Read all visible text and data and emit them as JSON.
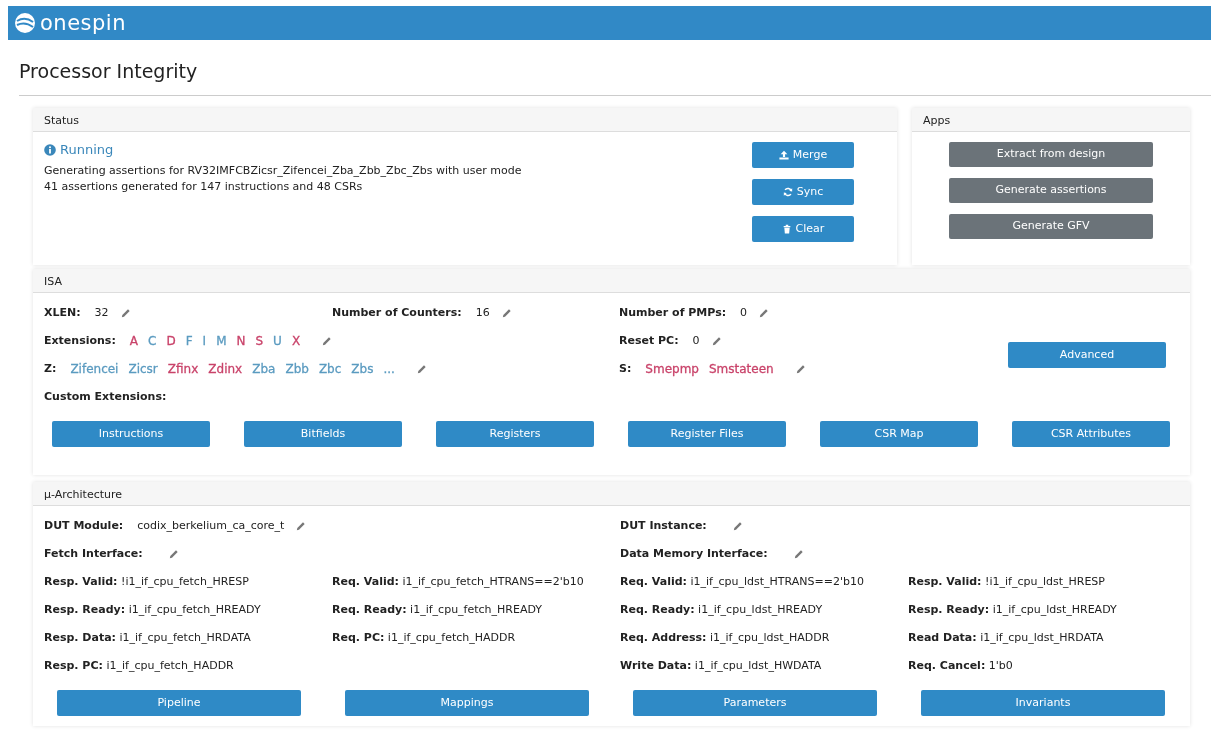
{
  "header": {
    "logo": "onespin"
  },
  "page_title": "Processor Integrity",
  "status": {
    "title": "Status",
    "state": "Running",
    "lines": [
      "Generating assertions for RV32IMFCBZicsr_Zifencei_Zba_Zbb_Zbc_Zbs with user mode",
      "41 assertions generated for 147 instructions and 48 CSRs"
    ],
    "buttons": [
      "Merge",
      "Sync",
      "Clear"
    ]
  },
  "apps": {
    "title": "Apps",
    "buttons": [
      "Extract from design",
      "Generate assertions",
      "Generate GFV"
    ]
  },
  "isa": {
    "title": "ISA",
    "items": [
      {
        "kind": "value",
        "label": "XLEN:",
        "value": "32",
        "editable": true
      },
      {
        "kind": "value",
        "label": "Number of Counters:",
        "value": "16",
        "editable": true
      },
      {
        "kind": "value",
        "label": "Number of PMPs:",
        "value": "0",
        "editable": true
      },
      {
        "kind": "tags",
        "label": "Extensions:",
        "editable": true,
        "tags": [
          {
            "text": "A",
            "color": "#c9436a"
          },
          {
            "text": "C",
            "color": "#5b9bc0"
          },
          {
            "text": "D",
            "color": "#c9436a"
          },
          {
            "text": "F",
            "color": "#5b9bc0"
          },
          {
            "text": "I",
            "color": "#5b9bc0"
          },
          {
            "text": "M",
            "color": "#5b9bc0"
          },
          {
            "text": "N",
            "color": "#c9436a"
          },
          {
            "text": "S",
            "color": "#c9436a"
          },
          {
            "text": "U",
            "color": "#5b9bc0"
          },
          {
            "text": "X",
            "color": "#c9436a"
          }
        ]
      },
      {
        "kind": "value",
        "label": "Reset PC:",
        "value": "0",
        "editable": true
      },
      {
        "kind": "tags",
        "label": "Z:",
        "editable": true,
        "tags": [
          {
            "text": "Zifencei",
            "color": "#5b9bc0"
          },
          {
            "text": "Zicsr",
            "color": "#5b9bc0"
          },
          {
            "text": "Zfinx",
            "color": "#c9436a"
          },
          {
            "text": "Zdinx",
            "color": "#c9436a"
          },
          {
            "text": "Zba",
            "color": "#5b9bc0"
          },
          {
            "text": "Zbb",
            "color": "#5b9bc0"
          },
          {
            "text": "Zbc",
            "color": "#5b9bc0"
          },
          {
            "text": "Zbs",
            "color": "#5b9bc0"
          }
        ],
        "more": "..."
      },
      {
        "kind": "tags",
        "label": "S:",
        "editable": true,
        "tags": [
          {
            "text": "Smepmp",
            "color": "#c9436a"
          },
          {
            "text": "Smstateen",
            "color": "#c9436a"
          }
        ]
      },
      {
        "kind": "value",
        "label": "Custom Extensions:",
        "editable": false
      }
    ],
    "advanced_button": "Advanced",
    "buttons": [
      "Instructions",
      "Bitfields",
      "Registers",
      "Register Files",
      "CSR Map",
      "CSR Attributes"
    ]
  },
  "uarch": {
    "title": "µ-Architecture",
    "groups": [
      {
        "fields": [
          {
            "label": "DUT Module:",
            "value": "codix_berkelium_ca_core_t",
            "editable": true
          },
          {
            "label": "Fetch Interface:",
            "editable": true
          }
        ],
        "signals": [
          {
            "label": "Resp. Valid:",
            "value": "!i1_if_cpu_fetch_HRESP"
          },
          {
            "label": "Req. Valid:",
            "value": "i1_if_cpu_fetch_HTRANS==2'b10"
          },
          {
            "label": "Resp. Ready:",
            "value": "i1_if_cpu_fetch_HREADY"
          },
          {
            "label": "Req. Ready:",
            "value": "i1_if_cpu_fetch_HREADY"
          },
          {
            "label": "Resp. Data:",
            "value": "i1_if_cpu_fetch_HRDATA"
          },
          {
            "label": "Req. PC:",
            "value": "i1_if_cpu_fetch_HADDR"
          },
          {
            "label": "Resp. PC:",
            "value": "i1_if_cpu_fetch_HADDR"
          }
        ],
        "buttons": [
          "Pipeline",
          "Mappings"
        ]
      },
      {
        "fields": [
          {
            "label": "DUT Instance:",
            "editable": true
          },
          {
            "label": "Data Memory Interface:",
            "editable": true
          }
        ],
        "signals": [
          {
            "label": "Req. Valid:",
            "value": "i1_if_cpu_ldst_HTRANS==2'b10"
          },
          {
            "label": "Resp. Valid:",
            "value": "!i1_if_cpu_ldst_HRESP"
          },
          {
            "label": "Req. Ready:",
            "value": "i1_if_cpu_ldst_HREADY"
          },
          {
            "label": "Resp. Ready:",
            "value": "i1_if_cpu_ldst_HREADY"
          },
          {
            "label": "Req. Address:",
            "value": "i1_if_cpu_ldst_HADDR"
          },
          {
            "label": "Read Data:",
            "value": "i1_if_cpu_ldst_HRDATA"
          },
          {
            "label": "Write Data:",
            "value": "i1_if_cpu_ldst_HWDATA"
          },
          {
            "label": "Req. Cancel:",
            "value": "1'b0"
          }
        ],
        "buttons": [
          "Parameters",
          "Invariants"
        ]
      }
    ]
  }
}
